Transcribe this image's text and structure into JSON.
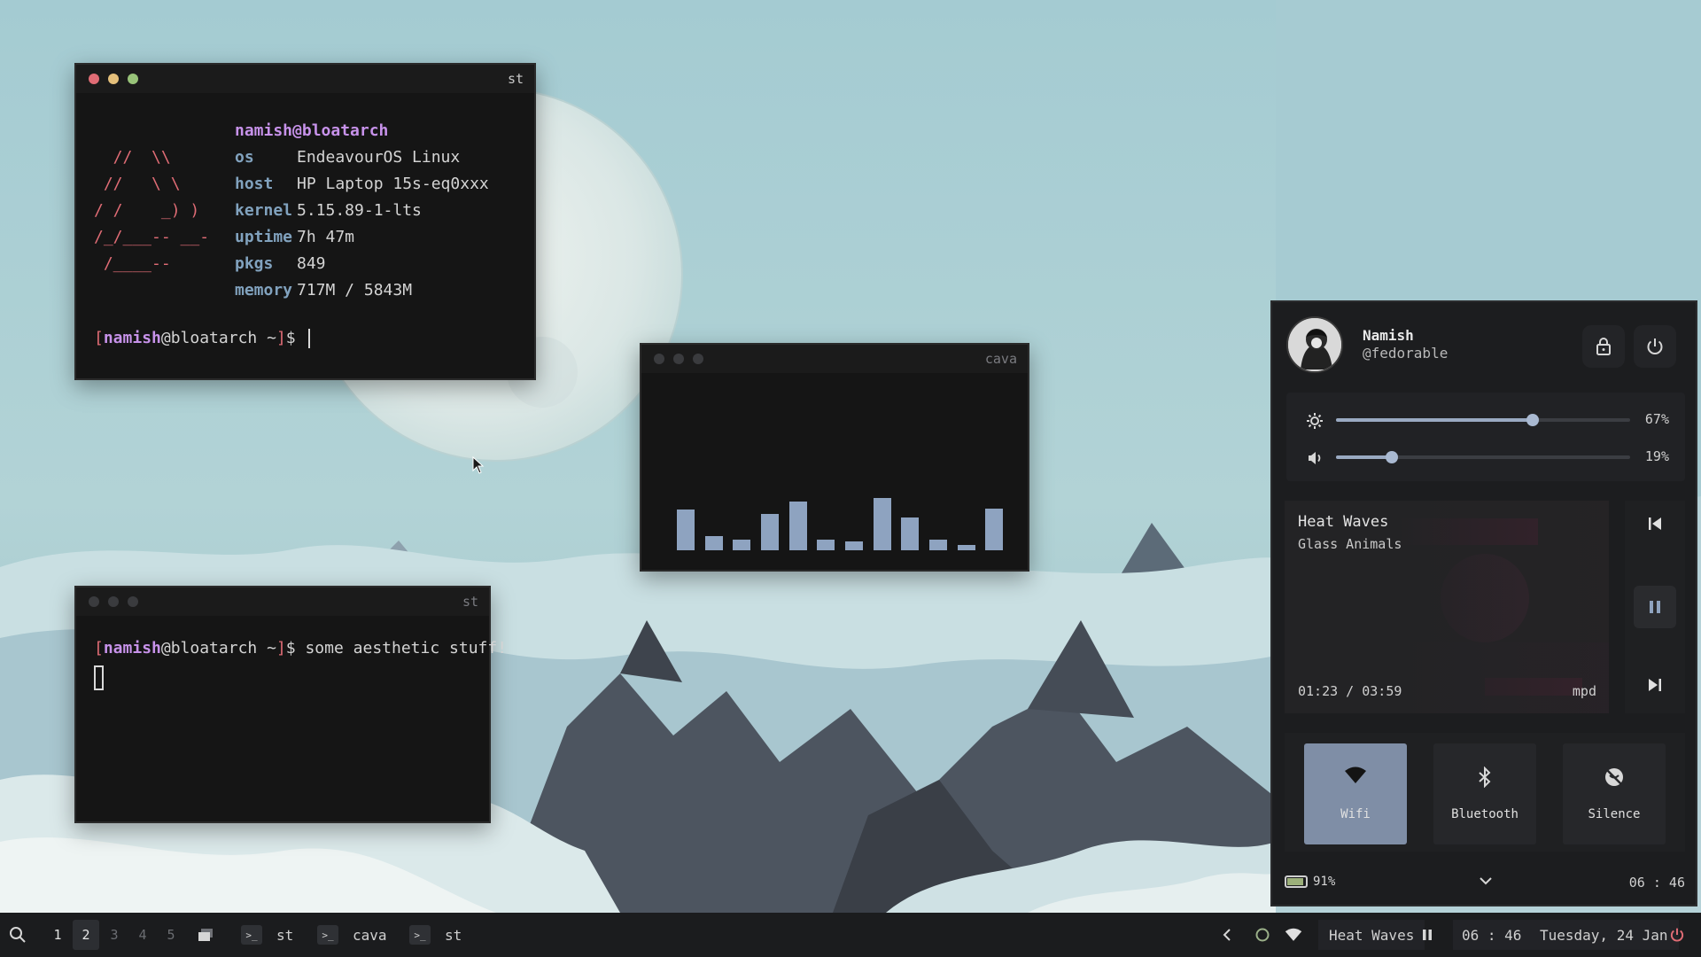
{
  "terminal_top": {
    "title": "st",
    "fetch": {
      "userhost": "namish@bloatarch",
      "art": [
        "",
        "  //  \\\\",
        " //   \\ \\",
        "/ /    _) )",
        "/_/___-- __-",
        " /____--",
        ""
      ],
      "rows": [
        {
          "key": "os",
          "value": "EndeavourOS Linux"
        },
        {
          "key": "host",
          "value": "HP Laptop 15s-eq0xxx"
        },
        {
          "key": "kernel",
          "value": "5.15.89-1-lts"
        },
        {
          "key": "uptime",
          "value": "7h 47m"
        },
        {
          "key": "pkgs",
          "value": "849"
        },
        {
          "key": "memory",
          "value": "717M / 5843M"
        }
      ]
    },
    "prompt": {
      "open": "[",
      "user": "namish",
      "at": "@bloatarch",
      "dir": " ~",
      "close": "]",
      "sign": "$"
    }
  },
  "cava": {
    "title": "cava",
    "levels": [
      0.38,
      0.13,
      0.1,
      0.34,
      0.46,
      0.1,
      0.08,
      0.49,
      0.31,
      0.1,
      0.05,
      0.39
    ]
  },
  "terminal_bottom": {
    "title": "st",
    "prompt": {
      "open": "[",
      "user": "namish",
      "at": "@bloatarch",
      "dir": " ~",
      "close": "]",
      "sign": "$",
      "command": " some aesthetic stuff!"
    }
  },
  "panel": {
    "user": {
      "name": "Namish",
      "handle": "@fedorable"
    },
    "brightness": {
      "value": 67,
      "label": "67%"
    },
    "volume": {
      "value": 19,
      "label": "19%"
    },
    "music": {
      "title": "Heat Waves",
      "artist": "Glass Animals",
      "time": "01:23 / 03:59",
      "source": "mpd"
    },
    "toggles": [
      {
        "label": "Wifi",
        "on": true
      },
      {
        "label": "Bluetooth",
        "on": false
      },
      {
        "label": "Silence",
        "on": false
      }
    ],
    "battery": {
      "value": 91,
      "label": "91%"
    },
    "time": "06 : 46"
  },
  "taskbar": {
    "workspaces": [
      "1",
      "2",
      "3",
      "4",
      "5"
    ],
    "tasks": [
      {
        "label": "st"
      },
      {
        "label": "cava"
      },
      {
        "label": "st"
      }
    ],
    "now_playing": "Heat Waves",
    "time": "06 : 46",
    "date": "Tuesday, 24 Jan"
  },
  "colors": {
    "accent": "#7f8ea6",
    "bar": "#8ea3c0",
    "red": "#e06c75",
    "purple": "#c792ea"
  }
}
